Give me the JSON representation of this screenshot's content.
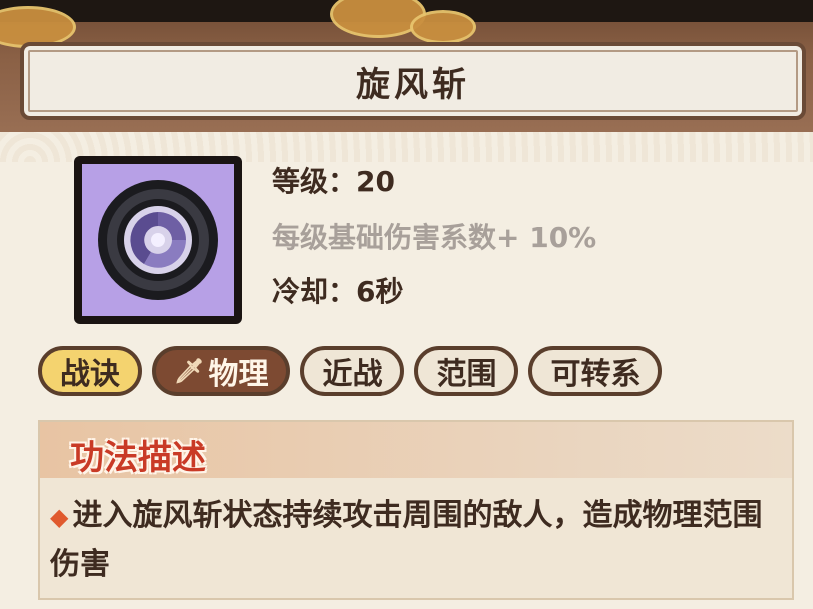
{
  "skill": {
    "name": "旋风斩",
    "level_text": "等级：20",
    "bonus_text": "每级基础伤害系数+ 10%",
    "cooldown_text": "冷却：6秒"
  },
  "tags": [
    "战诀",
    "物理",
    "近战",
    "范围",
    "可转系"
  ],
  "description": {
    "title": "功法描述",
    "text": "进入旋风斩状态持续攻击周围的敌人，造成物理范围伤害"
  },
  "icons": {
    "skill": "whirlwind-slash-icon",
    "physical_tag": "sword-icon",
    "bullet": "diamond-bullet-icon"
  },
  "colors": {
    "accent_red": "#c93a26",
    "tag_gold": "#f4d36f",
    "tag_brown": "#7d4a32",
    "icon_bg": "#b7a0e6"
  }
}
